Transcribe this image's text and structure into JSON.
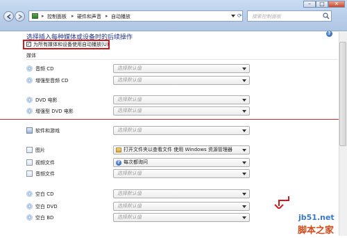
{
  "window": {
    "buttons": {
      "minimize": "–",
      "maximize": "□",
      "close": "✕"
    }
  },
  "address": {
    "segments": [
      "控制面板",
      "硬件和声音",
      "自动播放"
    ],
    "separator": "▸"
  },
  "search": {
    "placeholder": "搜索控制面板"
  },
  "heading": "选择插入每种媒体或设备时的后续操作",
  "use_autoplay": {
    "label": "为所有媒体和设备使用自动播放(U)",
    "checked": true
  },
  "media_group": "媒体",
  "rows": [
    {
      "label": "音频 CD",
      "value": "选择默认值"
    },
    {
      "label": "增强型音频 CD",
      "value": "选择默认值"
    },
    {
      "label": "DVD 电影",
      "value": "选择默认值"
    },
    {
      "label": "增强型 DVD 电影",
      "value": "选择默认值"
    },
    {
      "label": "软件和游戏",
      "value": "选择默认值"
    },
    {
      "label": "图片",
      "value": "打开文件夹以查看文件 使用 Windows 资源管理器"
    },
    {
      "label": "视频文件",
      "value": "每次都询问"
    },
    {
      "label": "音频文件",
      "value": "选择默认值"
    },
    {
      "label": "空白 CD",
      "value": "选择默认值"
    },
    {
      "label": "空白 DVD",
      "value": "选择默认值"
    },
    {
      "label": "空白 BD",
      "value": "选择默认值"
    }
  ],
  "watermark": {
    "site": "jb51.net",
    "name": "脚本之家"
  },
  "colors": {
    "heading": "#1e3287",
    "annotation": "#d01818",
    "titlebar": "#b7cde9"
  }
}
